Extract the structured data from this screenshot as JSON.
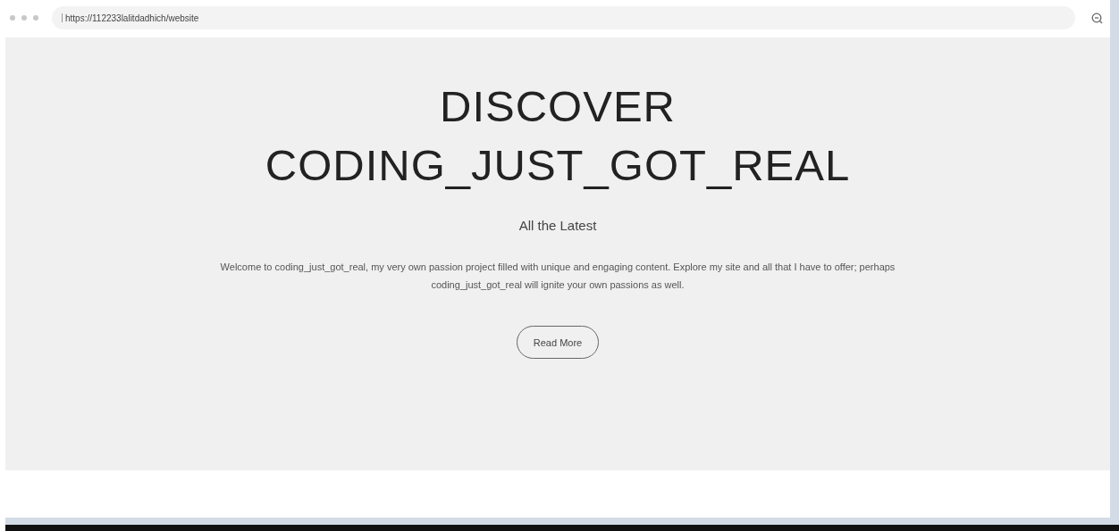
{
  "browser": {
    "url": "https://112233lalitdadhich/website"
  },
  "hero": {
    "title_lines": [
      "DISCOVER",
      "CODING_JUST_GOT_REAL"
    ],
    "subtitle": "All the Latest",
    "text": "Welcome to coding_just_got_real, my very own passion project filled with unique and engaging content. Explore my site and all that I have to offer; perhaps coding_just_got_real will ignite your own passions as well.",
    "button": "Read More"
  }
}
